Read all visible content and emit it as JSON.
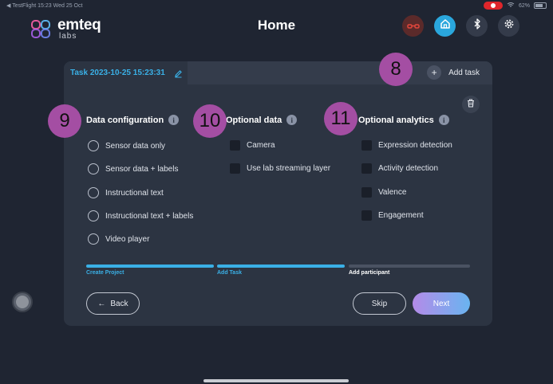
{
  "status_bar": {
    "back_app": "◀ TestFlight",
    "time": "15:23",
    "date": "Wed 25 Oct",
    "battery": "62%"
  },
  "logo": {
    "brand": "emteq",
    "sub": "labs"
  },
  "header": {
    "title": "Home"
  },
  "top_icons": [
    "glasses-icon",
    "home-icon",
    "bluetooth-icon",
    "gear-icon"
  ],
  "task_tab": {
    "label": "Task 2023-10-25 15:23:31"
  },
  "add_task": {
    "label": "Add task",
    "plus": "+"
  },
  "callouts": {
    "c8": "8",
    "c9": "9",
    "c10": "10",
    "c11": "11"
  },
  "sections": {
    "data_configuration": {
      "title": "Data configuration",
      "info": "i",
      "options": [
        "Sensor data only",
        "Sensor data + labels",
        "Instructional text",
        "Instructional text + labels",
        "Video player"
      ]
    },
    "optional_data": {
      "title": "Optional data",
      "info": "i",
      "options": [
        "Camera",
        "Use lab streaming layer"
      ]
    },
    "optional_analytics": {
      "title": "Optional analytics",
      "info": "i",
      "options": [
        "Expression detection",
        "Activity detection",
        "Valence",
        "Engagement"
      ]
    }
  },
  "progress": {
    "steps": [
      {
        "label": "Create Project",
        "state": "complete"
      },
      {
        "label": "Add Task",
        "state": "complete"
      },
      {
        "label": "Add participant",
        "state": "current"
      }
    ]
  },
  "buttons": {
    "back": "Back",
    "back_arrow": "←",
    "skip": "Skip",
    "next": "Next"
  },
  "colors": {
    "background": "#1f2532",
    "card": "#2c3442",
    "accent": "#3ab0e6",
    "callout": "#a44ea3",
    "next_gradient_start": "#b48be8",
    "next_gradient_end": "#69b4f0"
  }
}
